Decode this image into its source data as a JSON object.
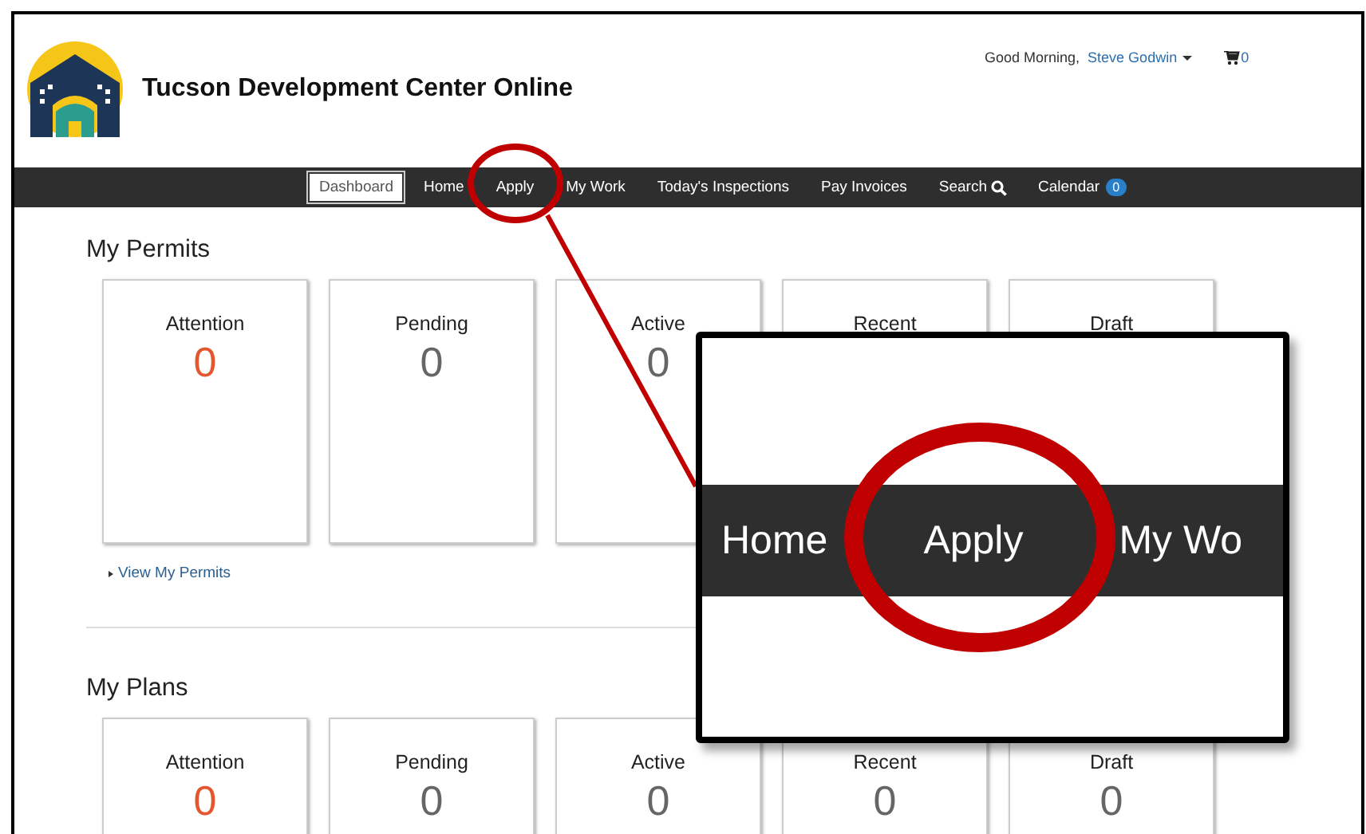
{
  "header": {
    "title": "Tucson Development Center Online",
    "greeting": "Good Morning,",
    "user": "Steve Godwin",
    "cart_count": "0"
  },
  "nav": [
    {
      "label": "Dashboard",
      "selected": true
    },
    {
      "label": "Home",
      "selected": false
    },
    {
      "label": "Apply",
      "selected": false
    },
    {
      "label": "My Work",
      "selected": false
    },
    {
      "label": "Today's Inspections",
      "selected": false
    },
    {
      "label": "Pay Invoices",
      "selected": false
    },
    {
      "label": "Search",
      "selected": false,
      "kind": "search"
    },
    {
      "label": "Calendar",
      "selected": false,
      "kind": "badge",
      "badge": "0"
    }
  ],
  "sections": [
    {
      "title": "My Permits",
      "link": "View My Permits",
      "cards": [
        {
          "label": "Attention",
          "count": "0",
          "color": "#e4572e"
        },
        {
          "label": "Pending",
          "count": "0",
          "color": "#666666"
        },
        {
          "label": "Active",
          "count": "0",
          "color": "#666666"
        },
        {
          "label": "Recent"
        },
        {
          "label": "Draft"
        }
      ]
    },
    {
      "title": "My Plans",
      "cards": [
        {
          "label": "Attention",
          "count": "0",
          "color": "#e4572e"
        },
        {
          "label": "Pending",
          "count": "0",
          "color": "#666666"
        },
        {
          "label": "Active",
          "count": "0",
          "color": "#666666"
        },
        {
          "label": "Recent",
          "count": "0",
          "color": "#666666"
        },
        {
          "label": "Draft",
          "count": "0",
          "color": "#666666"
        }
      ]
    }
  ],
  "callout": {
    "items": [
      "Home",
      "Apply",
      "My Wo"
    ]
  }
}
